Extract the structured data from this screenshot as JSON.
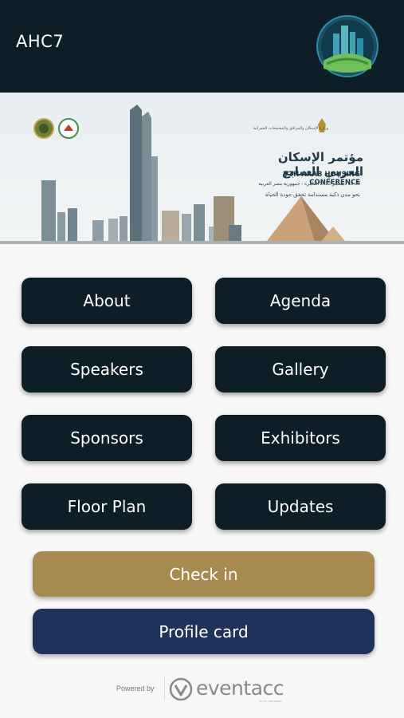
{
  "appbar": {
    "title": "AHC7",
    "logo_icon": "ahc7-city-logo"
  },
  "banner": {
    "ministry": "وزارة الإسكان والمرافق والمجتمعات العمرانية",
    "title_ar": "مؤتمر الإسكان العربي السابع",
    "title_en": "7TH ARAB HOUSING CONFERENCE",
    "date_ar": "18-20 ديسمبر 2022 القاهرة - جمهورية مصر العربية",
    "tagline_ar": "نحو مدن ذكية مستدامة تحقق جودة الحياة"
  },
  "menu": {
    "about": "About",
    "agenda": "Agenda",
    "speakers": "Speakers",
    "gallery": "Gallery",
    "sponsors": "Sponsors",
    "exhibitors": "Exhibitors",
    "floor_plan": "Floor Plan",
    "updates": "Updates"
  },
  "actions": {
    "check_in": "Check in",
    "profile_card": "Profile card"
  },
  "footer": {
    "powered_by": "Powered by",
    "brand": "eventacc",
    "brand_sub": "BY OCT NETWORK"
  },
  "colors": {
    "appbar": "#0d1e26",
    "menu_button": "#0d1e26",
    "check_in": "#a68a4f",
    "profile_card": "#21325a"
  }
}
